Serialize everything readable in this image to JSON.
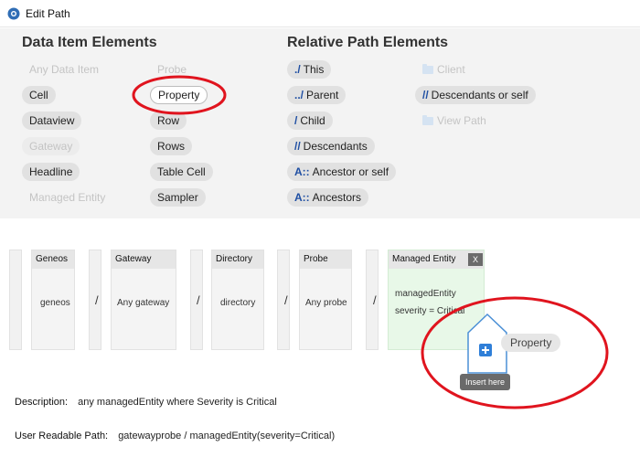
{
  "window": {
    "title": "Edit Path"
  },
  "data_items": {
    "title": "Data Item Elements",
    "col1": [
      {
        "label": "Any Data Item",
        "state": "disabled"
      },
      {
        "label": "Cell",
        "state": "normal"
      },
      {
        "label": "Dataview",
        "state": "normal"
      },
      {
        "label": "Gateway",
        "state": "disabled"
      },
      {
        "label": "Headline",
        "state": "normal"
      },
      {
        "label": "Managed Entity",
        "state": "disabled"
      }
    ],
    "col2": [
      {
        "label": "Probe",
        "state": "disabled"
      },
      {
        "label": "Property",
        "state": "selected"
      },
      {
        "label": "Row",
        "state": "normal"
      },
      {
        "label": "Rows",
        "state": "normal"
      },
      {
        "label": "Table Cell",
        "state": "normal"
      },
      {
        "label": "Sampler",
        "state": "normal"
      }
    ]
  },
  "relative_path": {
    "title": "Relative Path Elements",
    "col1": [
      {
        "prefix": "./",
        "label": "This"
      },
      {
        "prefix": "../",
        "label": "Parent"
      },
      {
        "prefix": "/",
        "label": "Child"
      },
      {
        "prefix": "//",
        "label": "Descendants"
      },
      {
        "prefix": "A::",
        "label": "Ancestor or self"
      },
      {
        "prefix": "A::",
        "label": "Ancestors"
      }
    ],
    "col2": [
      {
        "label": "Client",
        "icon": "folder-icon",
        "state": "disabled"
      },
      {
        "prefix": "//",
        "label": "Descendants or self",
        "state": "normal"
      },
      {
        "label": "View Path",
        "icon": "folder-icon",
        "state": "disabled"
      }
    ]
  },
  "path_segments": [
    {
      "header": "Geneos",
      "value": "geneos"
    },
    {
      "header": "Gateway",
      "value": "Any gateway"
    },
    {
      "header": "Directory",
      "value": "directory"
    },
    {
      "header": "Probe",
      "value": "Any probe"
    },
    {
      "header": "Managed Entity",
      "lines": [
        "managedEntity",
        "severity = Critical"
      ],
      "close": "X"
    }
  ],
  "separator": "/",
  "drop": {
    "ghost_label": "Property",
    "tooltip": "Insert here",
    "icon": "plus-icon"
  },
  "description": {
    "label": "Description:",
    "value": "any managedEntity where Severity is Critical"
  },
  "readable_path": {
    "label": "User Readable Path:",
    "value": "gatewayprobe / managedEntity(severity=Critical)"
  },
  "colors": {
    "annotation": "#e0141e",
    "accent": "#1f4fa3",
    "active_segment": "#e8f8e8"
  }
}
